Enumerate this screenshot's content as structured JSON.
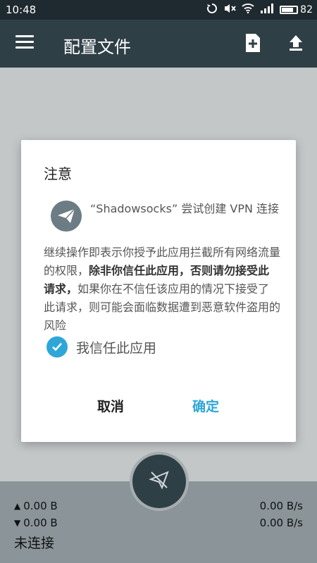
{
  "statusbar": {
    "time": "10:48",
    "battery_level": "82",
    "battery_fill": 0.82
  },
  "appbar": {
    "title": "配置文件"
  },
  "traffic": {
    "upload_total": "0.00 B",
    "download_total": "0.00 B",
    "upload_rate": "0.00 B/s",
    "download_rate": "0.00 B/s",
    "connection_status": "未连接"
  },
  "dialog": {
    "title": "注意",
    "request_text": "“Shadowsocks” 尝试创建 VPN 连接",
    "body_part1": "继续操作即表示你授予此应用拦截所有网络流量的权限，",
    "body_bold": "除非你信任此应用，否则请勿接受此请求，",
    "body_part2": "如果你在不信任该应用的情况下接受了此请求，则可能会面临数据遭到恶意软件盗用的风险",
    "trust_label": "我信任此应用",
    "trust_checked": true,
    "cancel_label": "取消",
    "ok_label": "确定"
  },
  "colors": {
    "accent": "#2ea6d8",
    "appbar": "#2f3f46",
    "overlay": "#c3c7c8"
  },
  "icons": {
    "menu": "menu-icon",
    "add_file": "add-file-icon",
    "upload": "upload-icon",
    "app": "paper-plane-icon",
    "connect": "paper-plane-off-icon",
    "check": "check-icon"
  }
}
